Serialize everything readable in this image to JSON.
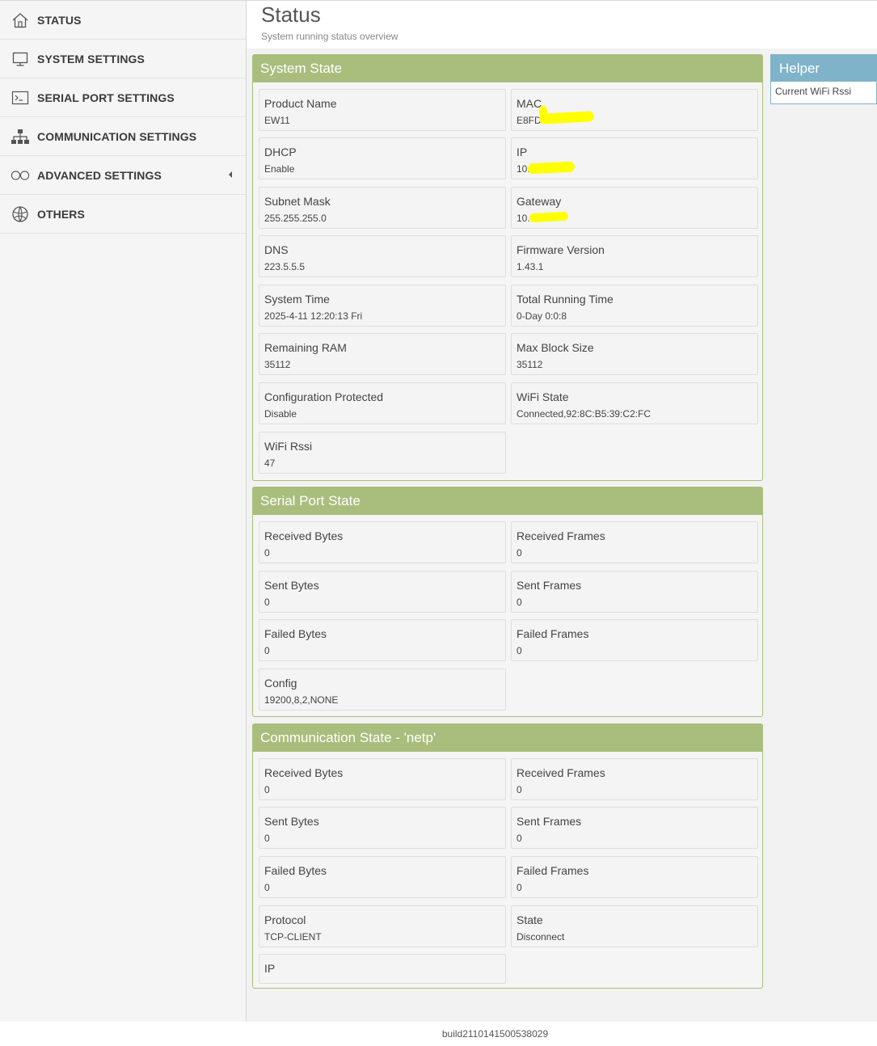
{
  "page": {
    "title": "Status",
    "subtitle": "System running status overview",
    "build": "build2110141500538029"
  },
  "sidebar": {
    "items": [
      {
        "label": "STATUS",
        "icon": "home-icon"
      },
      {
        "label": "SYSTEM SETTINGS",
        "icon": "monitor-icon"
      },
      {
        "label": "SERIAL PORT SETTINGS",
        "icon": "terminal-icon"
      },
      {
        "label": "COMMUNICATION SETTINGS",
        "icon": "network-icon"
      },
      {
        "label": "ADVANCED SETTINGS",
        "icon": "infinity-icon"
      },
      {
        "label": "OTHERS",
        "icon": "globe-icon"
      }
    ]
  },
  "system_state": {
    "title": "System State",
    "items": [
      {
        "label": "Product Name",
        "value": "EW11"
      },
      {
        "label": "MAC",
        "value": "E8FD"
      },
      {
        "label": "DHCP",
        "value": "Enable"
      },
      {
        "label": "IP",
        "value": "10."
      },
      {
        "label": "Subnet Mask",
        "value": "255.255.255.0"
      },
      {
        "label": "Gateway",
        "value": "10."
      },
      {
        "label": "DNS",
        "value": "223.5.5.5"
      },
      {
        "label": "Firmware Version",
        "value": "1.43.1"
      },
      {
        "label": "System Time",
        "value": "2025-4-11 12:20:13 Fri"
      },
      {
        "label": "Total Running Time",
        "value": "0-Day 0:0:8"
      },
      {
        "label": "Remaining RAM",
        "value": "35112"
      },
      {
        "label": "Max Block Size",
        "value": "35112"
      },
      {
        "label": "Configuration Protected",
        "value": "Disable"
      },
      {
        "label": "WiFi State",
        "value": "Connected,92:8C:B5:39:C2:FC"
      },
      {
        "label": "WiFi Rssi",
        "value": "47"
      }
    ]
  },
  "serial_state": {
    "title": "Serial Port State",
    "items": [
      {
        "label": "Received Bytes",
        "value": "0"
      },
      {
        "label": "Received Frames",
        "value": "0"
      },
      {
        "label": "Sent Bytes",
        "value": "0"
      },
      {
        "label": "Sent Frames",
        "value": "0"
      },
      {
        "label": "Failed Bytes",
        "value": "0"
      },
      {
        "label": "Failed Frames",
        "value": "0"
      },
      {
        "label": "Config",
        "value": "19200,8,2,NONE"
      }
    ]
  },
  "comm_state": {
    "title": "Communication State - 'netp'",
    "items": [
      {
        "label": "Received Bytes",
        "value": "0"
      },
      {
        "label": "Received Frames",
        "value": "0"
      },
      {
        "label": "Sent Bytes",
        "value": "0"
      },
      {
        "label": "Sent Frames",
        "value": "0"
      },
      {
        "label": "Failed Bytes",
        "value": "0"
      },
      {
        "label": "Failed Frames",
        "value": "0"
      },
      {
        "label": "Protocol",
        "value": "TCP-CLIENT"
      },
      {
        "label": "State",
        "value": "Disconnect"
      },
      {
        "label": "IP",
        "value": ""
      }
    ]
  },
  "helper": {
    "title": "Helper",
    "text": "Current WiFi Rssi"
  },
  "colors": {
    "panel_green": "#a9be7c",
    "helper_blue": "#7fb3c9",
    "redaction_yellow": "#ffff00"
  }
}
